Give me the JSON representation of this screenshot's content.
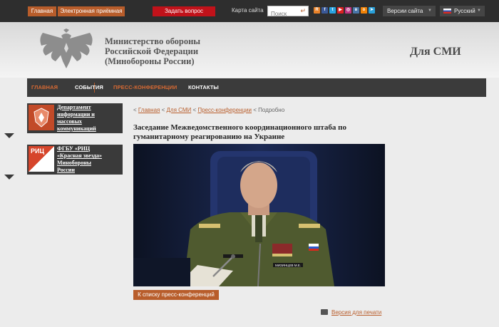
{
  "topbar": {
    "home": "Главная",
    "reception": "Электронная приёмная",
    "ask": "Задать вопрос",
    "sitemap": "Карта сайта",
    "search_placeholder": "Поиск",
    "versions": "Версии сайта",
    "language": "Русский"
  },
  "header": {
    "ministry_line1": "Министерство обороны",
    "ministry_line2": "Российской Федерации",
    "ministry_line3": "(Минобороны России)",
    "section": "Для СМИ"
  },
  "nav": [
    {
      "label": "ГЛАВНАЯ",
      "color": "#d86a33"
    },
    {
      "label": "СОБЫТИЯ",
      "color": "#ffffff"
    },
    {
      "label": "ПРЕСС-КОНФЕРЕНЦИИ",
      "color": "#d86a33"
    },
    {
      "label": "КОНТАКТЫ",
      "color": "#ffffff"
    }
  ],
  "sidebar": [
    {
      "line1": "Департамент",
      "line2": "информации и",
      "line3": "массовых",
      "line4": "коммуникаций"
    },
    {
      "line1": "ФГБУ «РИЦ",
      "line2": "«Красная звезда»",
      "line3": "Минобороны",
      "line4": "России",
      "badge": "РИЦ"
    }
  ],
  "breadcrumb": {
    "home": "Главная",
    "media": "Для СМИ",
    "press": "Пресс-конференции",
    "current": "Подробно"
  },
  "article": {
    "title": "Заседание Межведомственного координационного штаба по гуманитарному реагированию на Украине",
    "nameplate": "МИЗИНЦЕВ М.Е."
  },
  "back_button": "К списку пресс-конференций",
  "print_link": "Версия для печати",
  "colors": {
    "accent": "#b85d2b",
    "ask": "#c1121a",
    "dark": "#2e2e2e"
  }
}
